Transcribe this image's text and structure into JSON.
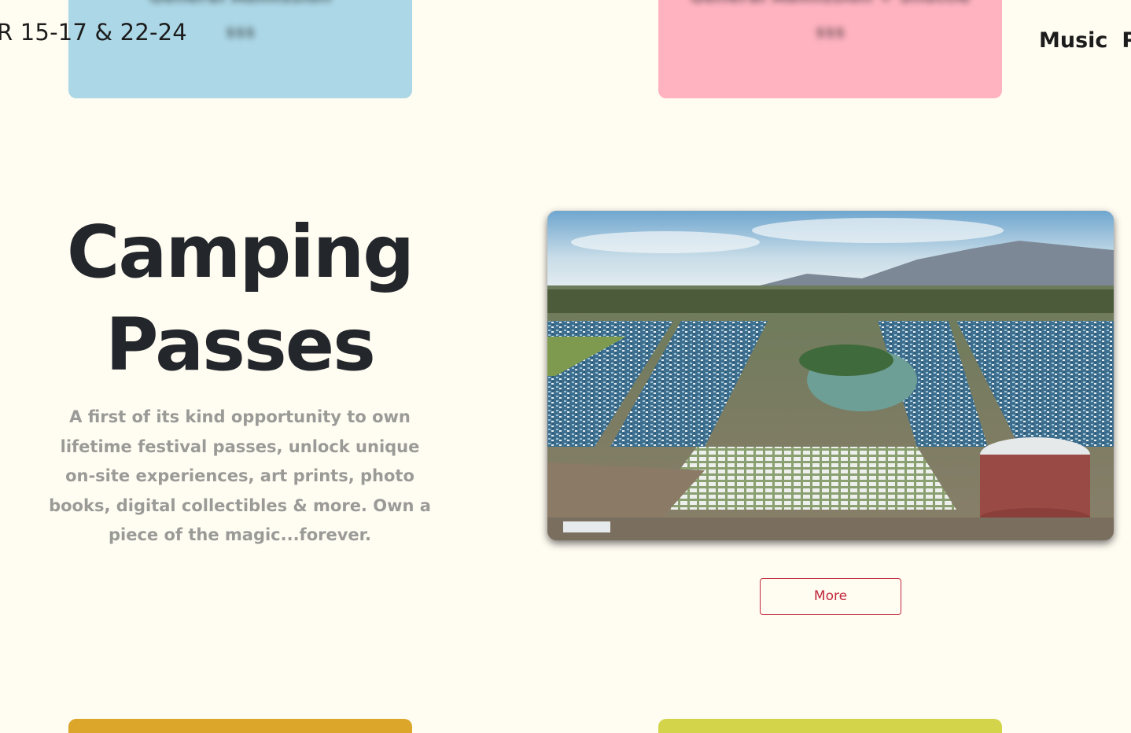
{
  "header": {
    "dates": "R 15-17 & 22-24",
    "nav": [
      {
        "label": "Music"
      },
      {
        "label": "Pa"
      }
    ]
  },
  "top_cards": [
    {
      "title": "General Admission",
      "price": "$$$",
      "color": "#acd7e6"
    },
    {
      "title": "General Admission + Shuttle",
      "price": "$$$",
      "color": "#ffb3c1"
    }
  ],
  "camping": {
    "title_line1": "Camping",
    "title_line2": "Passes",
    "description": "A first of its kind opportunity to own lifetime festival passes, unlock unique on-site experiences, art prints, photo books, digital collectibles & more. Own a piece of the magic...forever.",
    "button_label": "More"
  },
  "bottom_cards": [
    {
      "color": "#dba62a"
    },
    {
      "color": "#d3d44a"
    }
  ]
}
